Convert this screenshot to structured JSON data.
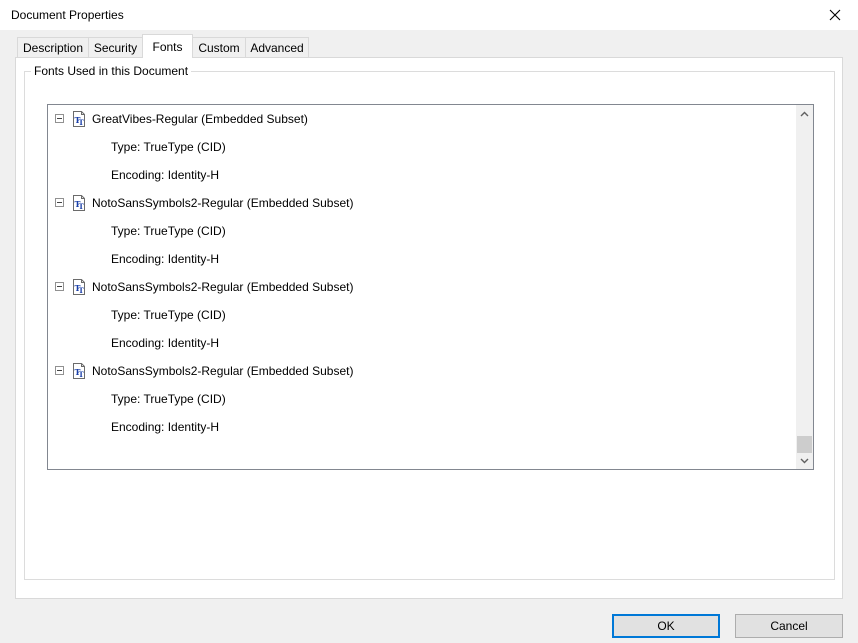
{
  "window": {
    "title": "Document Properties",
    "close_icon": "close-icon"
  },
  "tabs": [
    {
      "label": "Description",
      "active": false
    },
    {
      "label": "Security",
      "active": false
    },
    {
      "label": "Fonts",
      "active": true
    },
    {
      "label": "Custom",
      "active": false
    },
    {
      "label": "Advanced",
      "active": false
    }
  ],
  "fonts_group": {
    "label": "Fonts Used in this Document",
    "fonts": [
      {
        "name": "GreatVibes-Regular (Embedded Subset)",
        "type": "Type: TrueType (CID)",
        "encoding": "Encoding: Identity-H"
      },
      {
        "name": "NotoSansSymbols2-Regular (Embedded Subset)",
        "type": "Type: TrueType (CID)",
        "encoding": "Encoding: Identity-H"
      },
      {
        "name": "NotoSansSymbols2-Regular (Embedded Subset)",
        "type": "Type: TrueType (CID)",
        "encoding": "Encoding: Identity-H"
      },
      {
        "name": "NotoSansSymbols2-Regular (Embedded Subset)",
        "type": "Type: TrueType (CID)",
        "encoding": "Encoding: Identity-H"
      }
    ]
  },
  "buttons": {
    "ok": "OK",
    "cancel": "Cancel"
  },
  "colors": {
    "default_button_border": "#0078d7",
    "tree_border": "#828790",
    "font_icon_glyph": "#1a3fa8"
  }
}
